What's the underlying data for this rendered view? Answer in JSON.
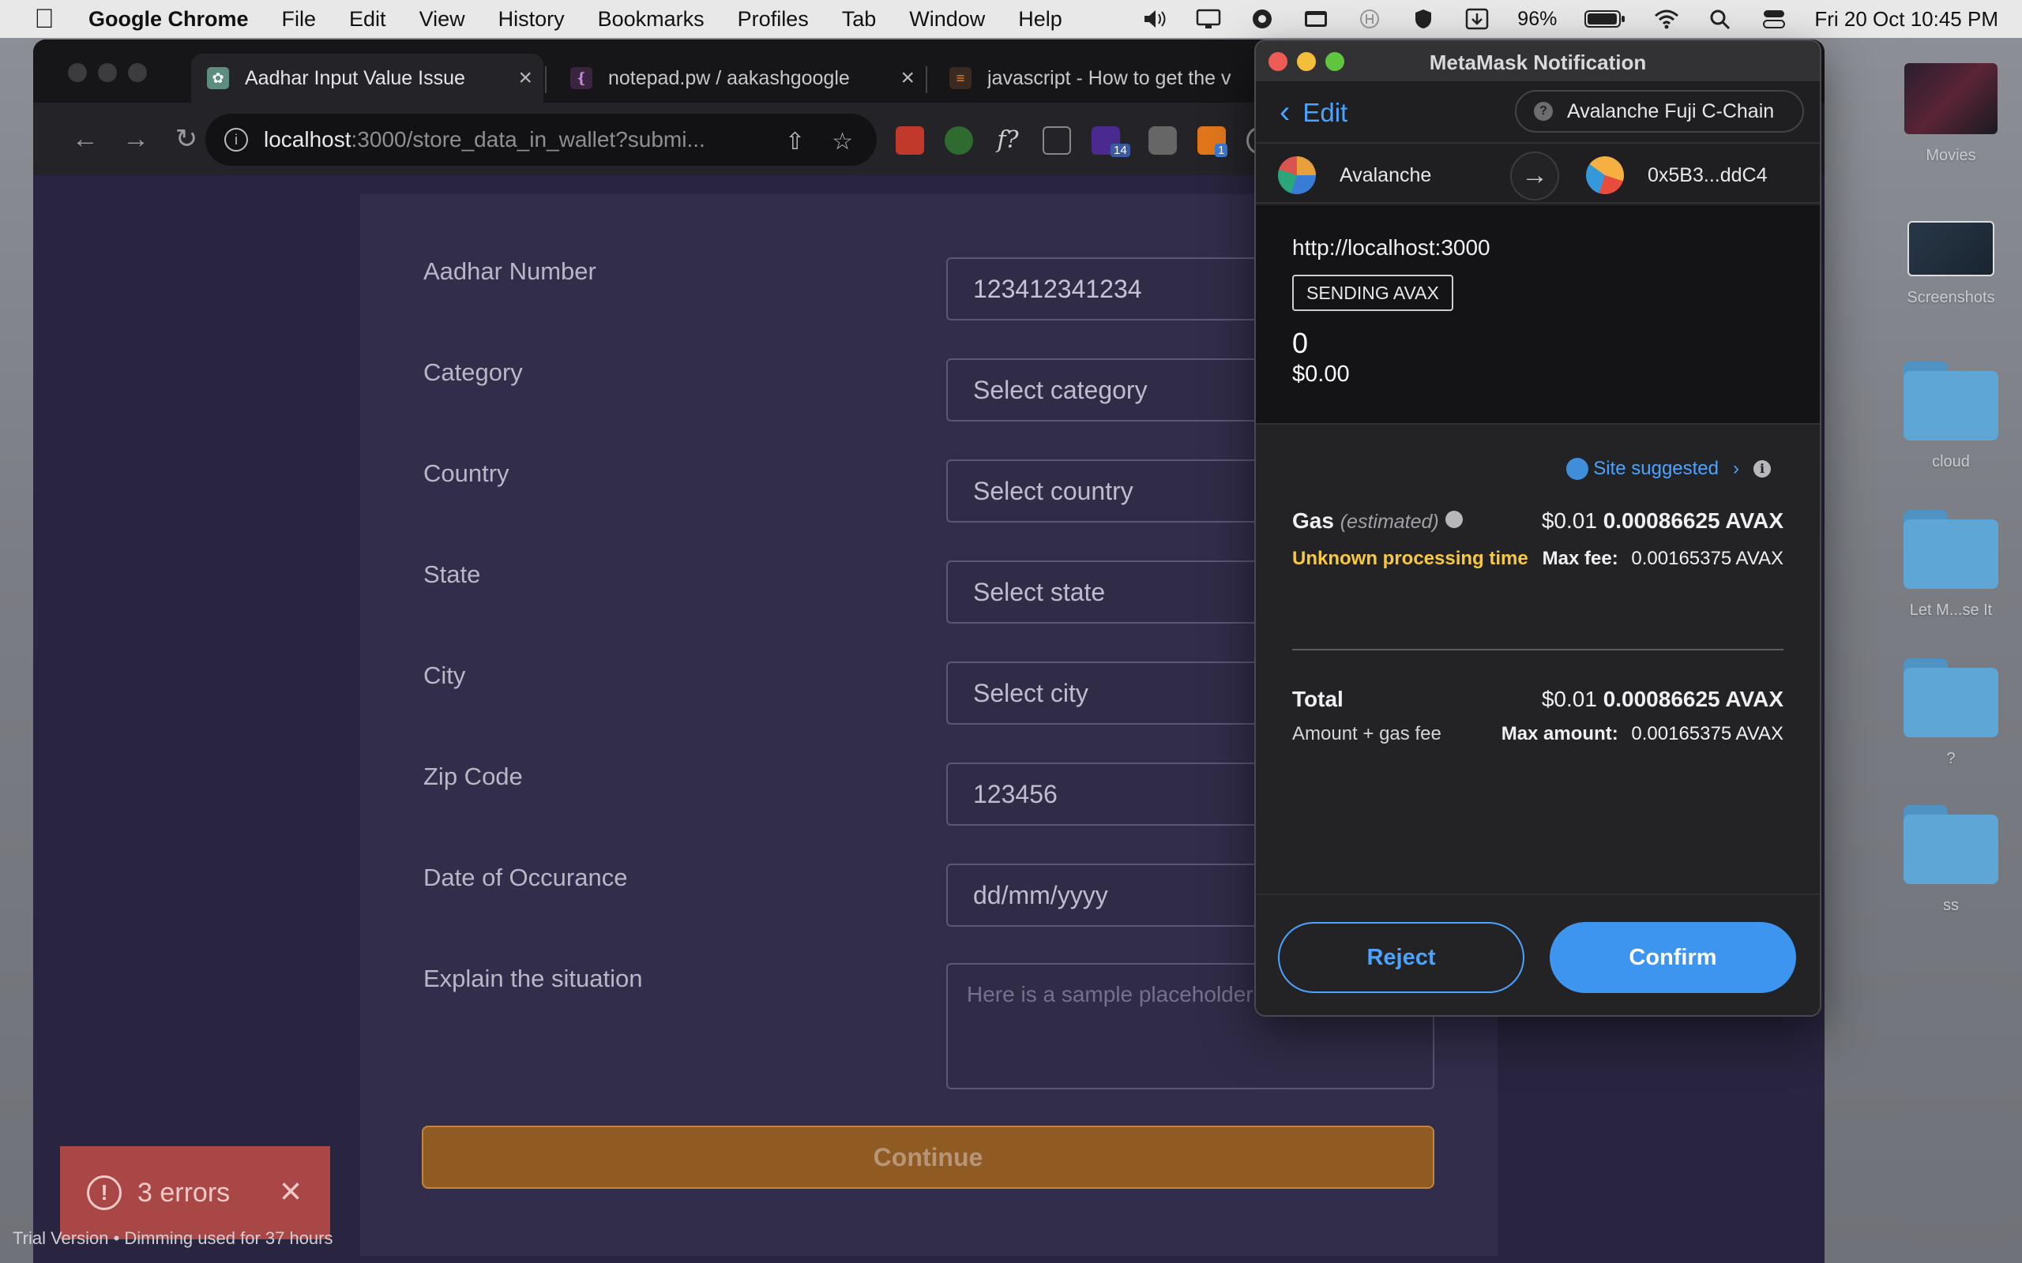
{
  "menubar": {
    "app_name": "Google Chrome",
    "items": [
      "File",
      "Edit",
      "View",
      "History",
      "Bookmarks",
      "Profiles",
      "Tab",
      "Window",
      "Help"
    ],
    "battery": "96%",
    "datetime": "Fri 20 Oct  10:45 PM"
  },
  "desktop": {
    "items": [
      "Movies",
      "Screenshots",
      "cloud",
      "Let M...se It",
      "?",
      "ss"
    ]
  },
  "chrome": {
    "tabs": [
      {
        "title": "Aadhar Input Value Issue"
      },
      {
        "title": "notepad.pw / aakashgoogle"
      },
      {
        "title": "javascript - How to get the v"
      }
    ],
    "url_host": "localhost",
    "url_rest": ":3000/store_data_in_wallet?submi...",
    "extension_badges": [
      "14",
      "1"
    ]
  },
  "form": {
    "fields": [
      {
        "label": "Aadhar Number",
        "value": "123412341234"
      },
      {
        "label": "Category",
        "value": "Select category"
      },
      {
        "label": "Country",
        "value": "Select country"
      },
      {
        "label": "State",
        "value": "Select state"
      },
      {
        "label": "City",
        "value": "Select city"
      },
      {
        "label": "Zip Code",
        "value": "123456"
      },
      {
        "label": "Date of Occurance",
        "value": "dd/mm/yyyy"
      }
    ],
    "textarea_label": "Explain the situation",
    "textarea_placeholder": "Here is a sample placeholder",
    "continue_label": "Continue"
  },
  "toast": {
    "text": "3 errors"
  },
  "trial_text": "Trial Version • Dimming used for 37 hours",
  "metamask": {
    "window_title": "MetaMask Notification",
    "edit_label": "Edit",
    "network": "Avalanche Fuji C-Chain",
    "from_account": "Avalanche",
    "to_account": "0x5B3...ddC4",
    "origin": "http://localhost:3000",
    "badge": "SENDING AVAX",
    "amount": "0",
    "amount_usd": "$0.00",
    "site_suggested": "Site suggested",
    "gas_label": "Gas",
    "gas_estimated": "(estimated)",
    "gas_usd": "$0.01",
    "gas_avax": "0.00086625 AVAX",
    "processing": "Unknown processing time",
    "max_fee_label": "Max fee:",
    "max_fee_value": "0.00165375 AVAX",
    "total_label": "Total",
    "total_sub": "Amount + gas fee",
    "total_usd": "$0.01",
    "total_avax": "0.00086625 AVAX",
    "max_amount_label": "Max amount:",
    "max_amount_value": "0.00165375 AVAX",
    "reject_label": "Reject",
    "confirm_label": "Confirm"
  }
}
